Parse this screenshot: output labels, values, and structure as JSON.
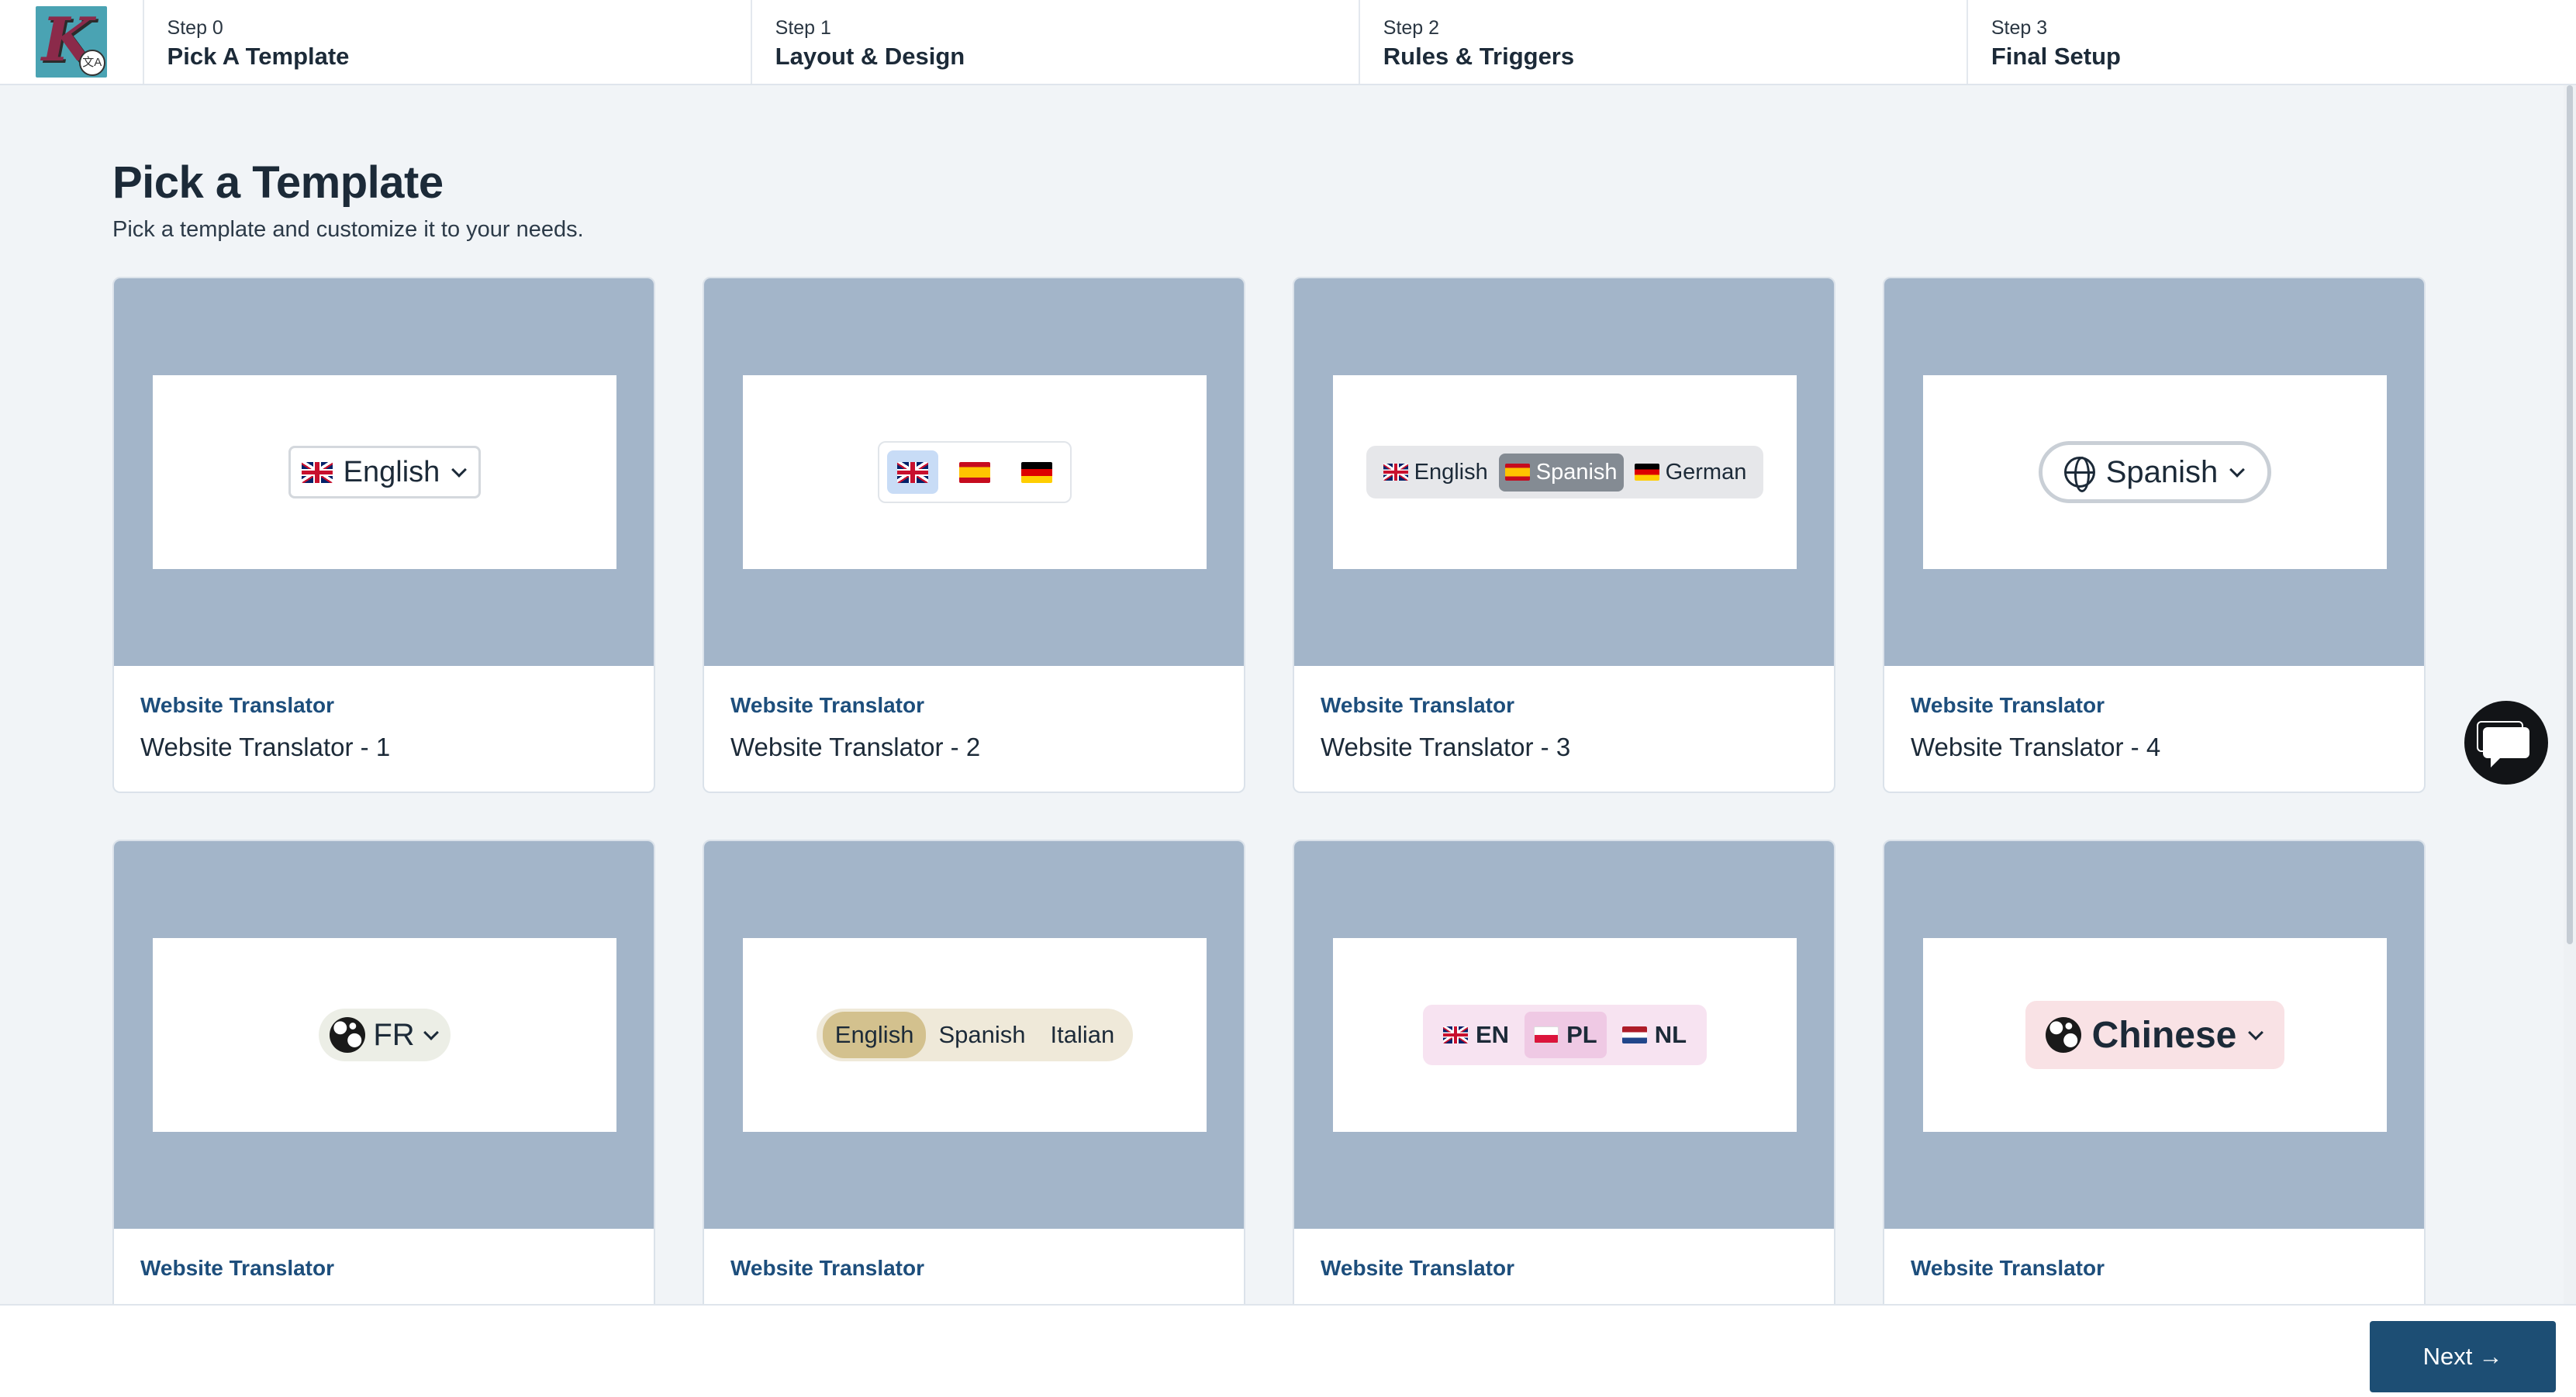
{
  "steps": [
    {
      "num": "Step 0",
      "title": "Pick A Template"
    },
    {
      "num": "Step 1",
      "title": "Layout & Design"
    },
    {
      "num": "Step 2",
      "title": "Rules & Triggers"
    },
    {
      "num": "Step 3",
      "title": "Final Setup"
    }
  ],
  "page": {
    "title": "Pick a Template",
    "subtitle": "Pick a template and customize it to your needs."
  },
  "templates": [
    {
      "category": "Website Translator",
      "name": "Website Translator - 1",
      "widget": {
        "label": "English"
      }
    },
    {
      "category": "Website Translator",
      "name": "Website Translator - 2",
      "widget": {}
    },
    {
      "category": "Website Translator",
      "name": "Website Translator - 3",
      "widget": {
        "options": [
          "English",
          "Spanish",
          "German"
        ]
      }
    },
    {
      "category": "Website Translator",
      "name": "Website Translator - 4",
      "widget": {
        "label": "Spanish"
      }
    },
    {
      "category": "Website Translator",
      "name": "",
      "widget": {
        "label": "FR"
      }
    },
    {
      "category": "Website Translator",
      "name": "",
      "widget": {
        "options": [
          "English",
          "Spanish",
          "Italian"
        ]
      }
    },
    {
      "category": "Website Translator",
      "name": "",
      "widget": {
        "options": [
          "EN",
          "PL",
          "NL"
        ]
      }
    },
    {
      "category": "Website Translator",
      "name": "",
      "widget": {
        "label": "Chinese"
      }
    }
  ],
  "footer": {
    "next_label": "Next",
    "next_arrow": "→"
  },
  "icons": {
    "logo": "app-logo-icon",
    "chat": "chat-bubble-icon"
  },
  "colors": {
    "accent": "#1d4e74",
    "preview_bg": "#a3b5c9",
    "category_text": "#1d4e7c"
  }
}
